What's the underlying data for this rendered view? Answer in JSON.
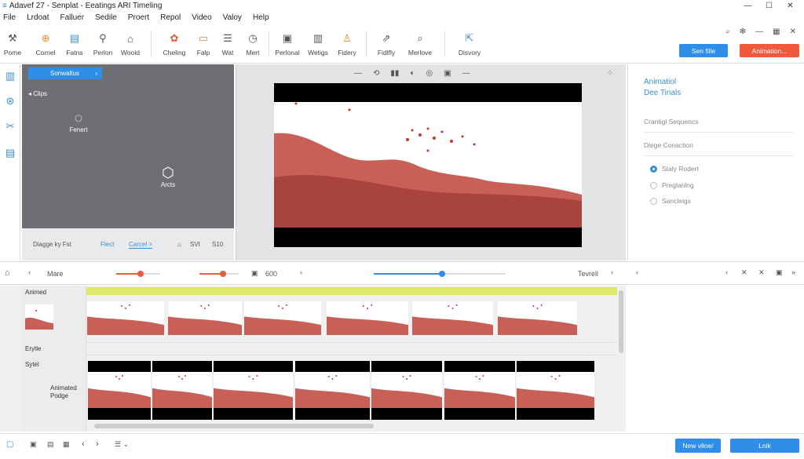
{
  "window": {
    "title": "Adavef 27 - Senplat - Eeatings ARI Timeling",
    "app_icon": "app-icon",
    "controls": [
      "—",
      "☐",
      "✕"
    ]
  },
  "menu": [
    "File",
    "Lrdoat",
    "Falluer",
    "Sedile",
    "Proert",
    "Repol",
    "Video",
    "Valoy",
    "Help"
  ],
  "ribbon": {
    "items": [
      {
        "label": "Pome",
        "icon": "wrench-icon"
      },
      {
        "label": "Cornel",
        "icon": "folder-add-icon"
      },
      {
        "label": "Fatns",
        "icon": "document-icon"
      },
      {
        "label": "Perlon",
        "icon": "pin-icon"
      },
      {
        "label": "Wooid",
        "icon": "bookmark-icon"
      },
      {
        "label": "Cheling",
        "icon": "settings-icon"
      },
      {
        "label": "Falp",
        "icon": "folder-icon"
      },
      {
        "label": "Wat",
        "icon": "list-icon"
      },
      {
        "label": "Mert",
        "icon": "clock-icon"
      },
      {
        "label": "Perlonal",
        "icon": "image-icon"
      },
      {
        "label": "Wetigs",
        "icon": "pages-icon"
      },
      {
        "label": "Fidery",
        "icon": "user-icon"
      },
      {
        "label": "Fidlfly",
        "icon": "export-icon"
      },
      {
        "label": "Merlove",
        "icon": "search-doc-icon"
      },
      {
        "label": "Disvory",
        "icon": "share-icon"
      }
    ],
    "save_btn": "Sen fille",
    "animation_btn": "Animation..."
  },
  "asset_panel": {
    "tab": "Sonwaltus",
    "section": "Clips",
    "item1": "Fenert",
    "item2": "Arcts",
    "footer_left": "Diagge ky Fst",
    "footer_mid": "Flect",
    "footer_cancel": "Carcel >",
    "footer_right": "SVI",
    "footer_num": "S10"
  },
  "preview": {
    "tools": [
      "—",
      "⟲",
      "▮▮",
      "◐",
      "◎",
      "▣",
      "—"
    ]
  },
  "inspector": {
    "title1": "Animatiol",
    "title2": "Dee Tinals",
    "section1": "Crantigl Sequencs",
    "section2": "Dlege Conaction",
    "options": [
      {
        "label": "Staly Rodert",
        "selected": true
      },
      {
        "label": "Preglanlng",
        "selected": false
      },
      {
        "label": "Sancleigs",
        "selected": false
      }
    ]
  },
  "timeline_bar": {
    "label": "Mare",
    "value": "600",
    "right_label": "Tevrell",
    "slider1": 0.55,
    "slider2": 0.6,
    "slider3": 0.52
  },
  "tracks": {
    "track1": "Animed",
    "track2": "Erytle",
    "track3": "Sytel",
    "track3_sub1": "Animated",
    "track3_sub2": "Podge"
  },
  "bottom": {
    "new_video": "New vlloe/",
    "link": "Lnik"
  },
  "colors": {
    "accent": "#2f8fe8",
    "orange": "#f05a3c",
    "panel_dark": "#6d6f73"
  }
}
